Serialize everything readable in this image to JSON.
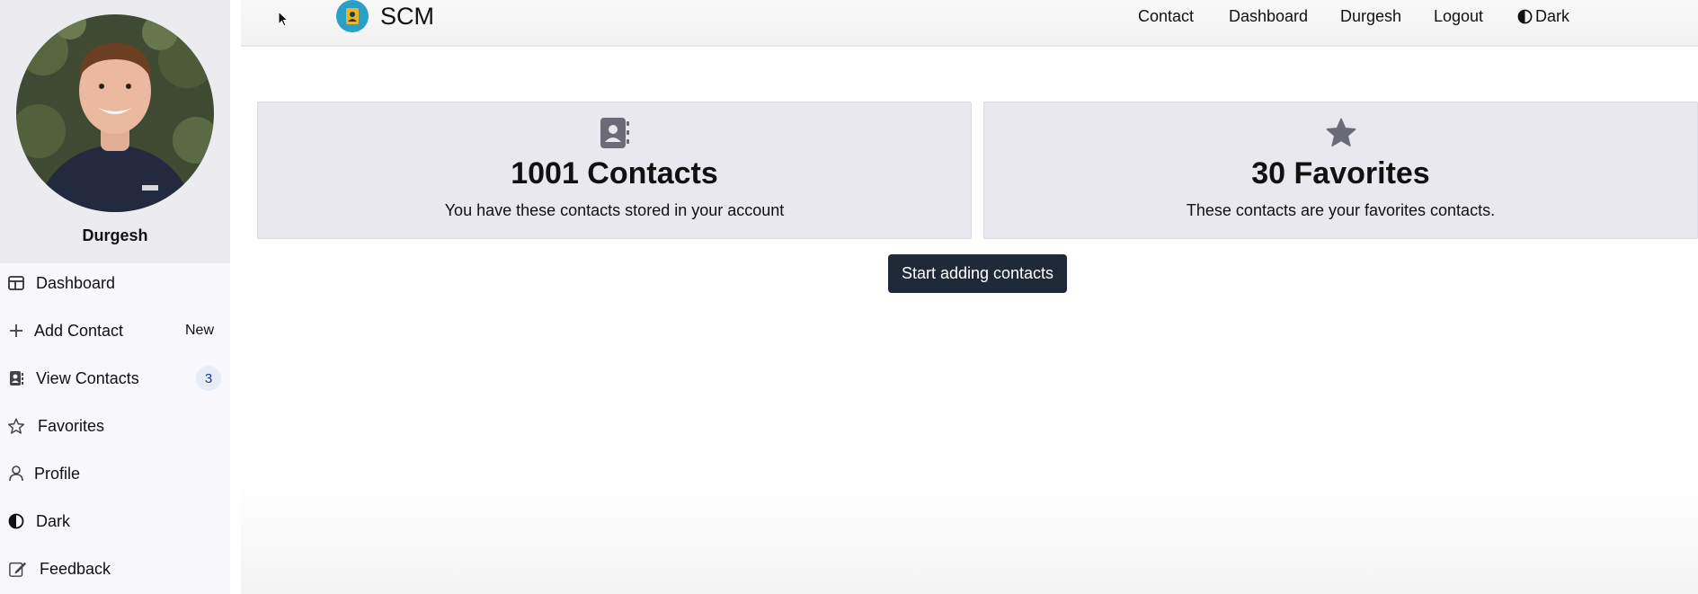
{
  "navbar": {
    "brand": "SCM",
    "links": [
      "Contact",
      "Dashboard",
      "Durgesh",
      "Logout",
      "Dark"
    ]
  },
  "sidebar": {
    "user_name": "Durgesh",
    "items": [
      {
        "label": "Dashboard",
        "icon": "dashboard-icon"
      },
      {
        "label": "Add Contact",
        "icon": "plus-icon",
        "badge": "New"
      },
      {
        "label": "View Contacts",
        "icon": "contact-book-icon",
        "badge": "3"
      },
      {
        "label": "Favorites",
        "icon": "star-icon"
      },
      {
        "label": "Profile",
        "icon": "user-icon"
      },
      {
        "label": "Dark",
        "icon": "theme-toggle-icon"
      },
      {
        "label": "Feedback",
        "icon": "feedback-icon"
      }
    ]
  },
  "main": {
    "cards": [
      {
        "title": "1001 Contacts",
        "description": "You have these contacts stored in your account",
        "icon": "contact-book-icon"
      },
      {
        "title": "30 Favorites",
        "description": "These contacts are your favorites contacts.",
        "icon": "star-icon"
      }
    ],
    "cta_label": "Start adding contacts"
  },
  "colors": {
    "sidebar_bg": "#f8f7fc",
    "card_bg": "#e8e8ee",
    "button_bg": "#1f2937",
    "brand_logo_bg": "#2a9fc8"
  }
}
